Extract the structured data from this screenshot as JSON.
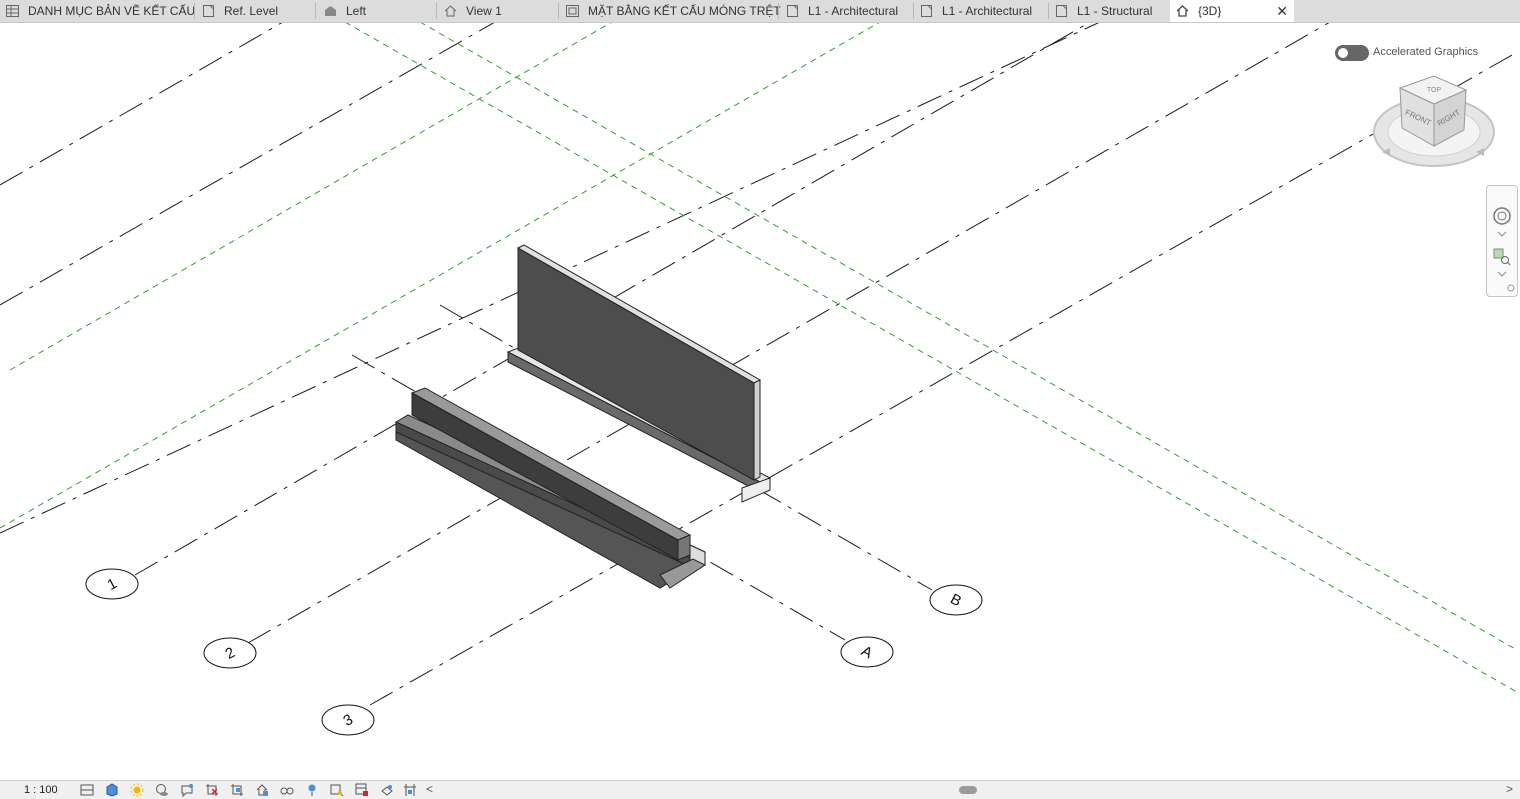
{
  "tabs": [
    {
      "label": "DANH MỤC BẢN VẼ KẾT CẤU",
      "icon": "schedule-icon"
    },
    {
      "label": "Ref. Level",
      "icon": "sheet-icon"
    },
    {
      "label": "Left",
      "icon": "elevation-icon"
    },
    {
      "label": "View 1",
      "icon": "home-icon"
    },
    {
      "label": "MẶT BẰNG KẾT CẤU MÓNG TRỆT",
      "icon": "sheet-icon"
    },
    {
      "label": "L1 - Architectural",
      "icon": "sheet-icon"
    },
    {
      "label": "L1 - Architectural",
      "icon": "sheet-icon"
    },
    {
      "label": "L1 - Structural",
      "icon": "sheet-icon"
    },
    {
      "label": "{3D}",
      "icon": "home-icon",
      "active": true
    }
  ],
  "tab_close_label": "✕",
  "viewport": {
    "accelerated_graphics": {
      "label": "Accelerated Graphics",
      "enabled": false
    },
    "viewcube": {
      "top": "TOP",
      "front": "FRONT",
      "right": "RIGHT"
    },
    "grids": {
      "numbered": [
        "1",
        "2",
        "3"
      ],
      "lettered": [
        "A",
        "B"
      ]
    }
  },
  "statusbar": {
    "scale": "1 : 100",
    "icons": [
      "detail-level-icon",
      "visual-style-icon",
      "sun-path-icon",
      "shadows-icon",
      "render-icon",
      "crop-view-icon",
      "crop-region-icon",
      "unlock-3d-view-icon",
      "temporary-hide-icon",
      "reveal-hidden-icon",
      "analytical-model-icon",
      "highlight-displacement-icon",
      "worksharing-icon",
      "constraints-icon",
      "reveal-constraints-icon"
    ],
    "scroll_left": "<",
    "scroll_right": ">"
  },
  "colors": {
    "grid_line": "#1a1a1a",
    "level_line": "#3a9a3a",
    "wall_face": "#4d4d4d",
    "tab_bar": "#dcdcdc"
  }
}
